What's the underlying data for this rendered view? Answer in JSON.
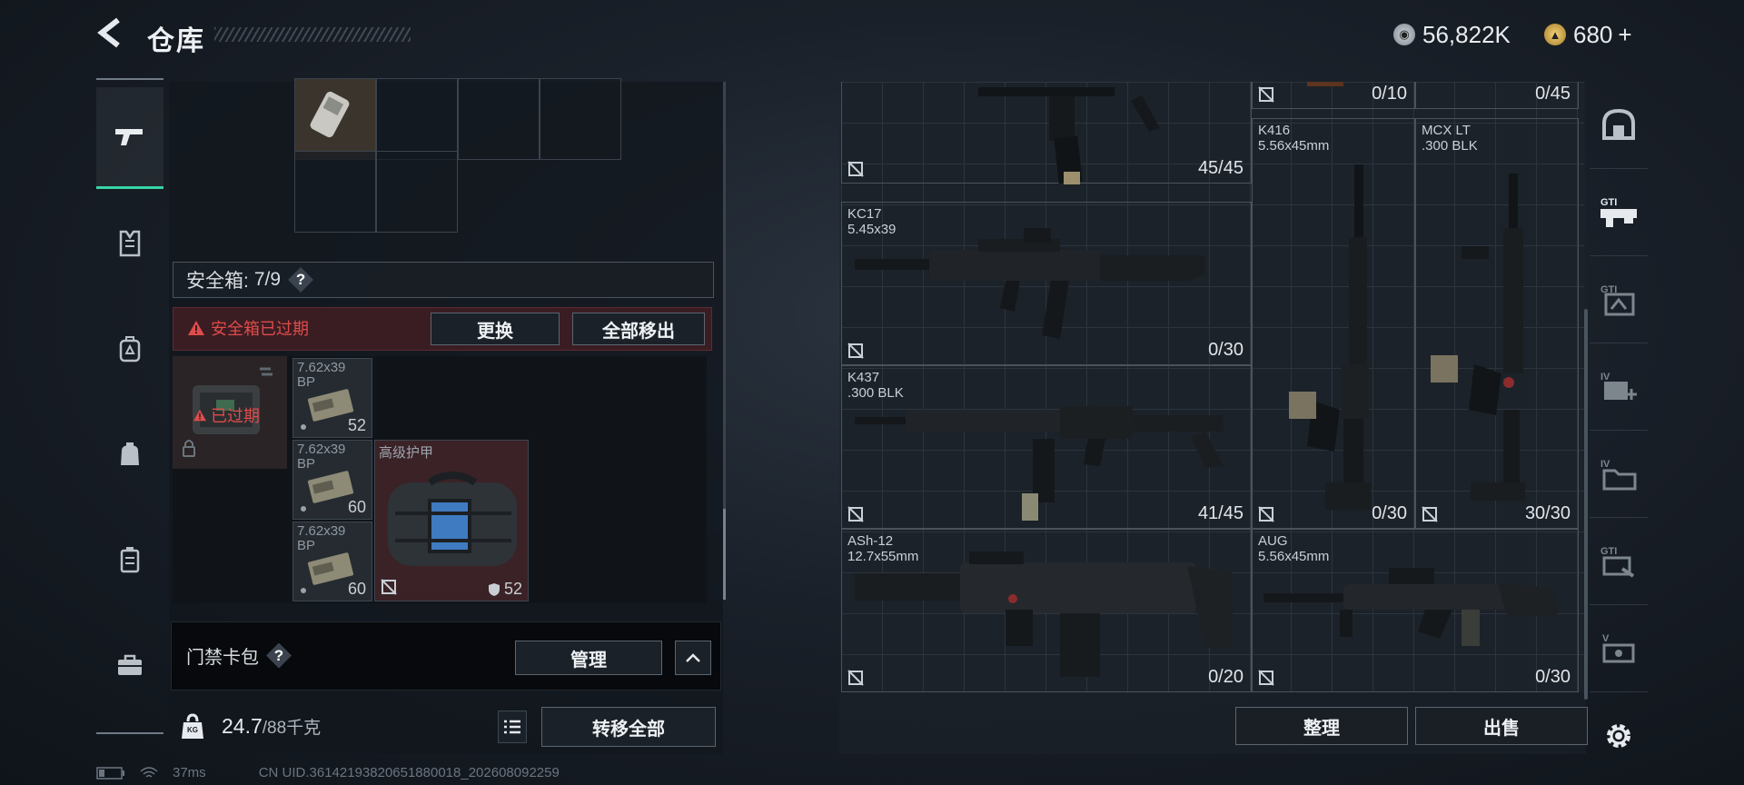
{
  "header": {
    "title": "仓库",
    "currency_primary": "56,822K",
    "currency_secondary": "680",
    "currency_secondary_plus": "+"
  },
  "safe_box": {
    "label": "安全箱:",
    "capacity": "7/9",
    "help": "?",
    "expired_notice": "安全箱已过期",
    "replace_button": "更换",
    "remove_all_button": "全部移出",
    "expired_badge": "已过期",
    "items": [
      {
        "label": "7.62x39",
        "sub": "BP",
        "count": "52"
      },
      {
        "label": "7.62x39",
        "sub": "BP",
        "count": "60"
      },
      {
        "label": "7.62x39",
        "sub": "BP",
        "count": "60"
      }
    ],
    "armor": {
      "label": "高级护甲",
      "durability": "52"
    }
  },
  "keycard": {
    "label": "门禁卡包",
    "help": "?",
    "manage_button": "管理"
  },
  "weight": {
    "current": "24.7",
    "max": "/88千克",
    "icon_text": "KG",
    "transfer_all_button": "转移全部"
  },
  "status_bar": {
    "ping": "37ms",
    "uid": "CN UID.3614219382065188001​8_202608092259"
  },
  "weapons": [
    {
      "name": "",
      "caliber": "",
      "count": "45/45"
    },
    {
      "name": "",
      "caliber": "",
      "count": "0/10"
    },
    {
      "name": "",
      "caliber": "",
      "count": "0/45"
    },
    {
      "name": "KC17",
      "caliber": "5.45x39",
      "count": "0/30"
    },
    {
      "name": "K416",
      "caliber": "5.56x45mm",
      "count": "0/30"
    },
    {
      "name": "MCX LT",
      "caliber": ".300 BLK",
      "count": "30/30"
    },
    {
      "name": "K437",
      "caliber": ".300 BLK",
      "count": "41/45"
    },
    {
      "name": "ASh-12",
      "caliber": "12.7x55mm",
      "count": "0/20"
    },
    {
      "name": "AUG",
      "caliber": "5.56x45mm",
      "count": "0/30"
    }
  ],
  "actions": {
    "sort_button": "整理",
    "sell_button": "出售"
  },
  "colors": {
    "accent": "#37d4a6",
    "danger": "#e04b4b",
    "coin_gold": "#d9b253"
  },
  "left_rail_icons": [
    "pistol-icon",
    "vest-icon",
    "backpack-icon",
    "bag-icon",
    "container-icon",
    "toolbox-icon"
  ],
  "right_rail_icons": [
    "helmet-icon",
    "gti-rifle-icon",
    "gti-mod-icon",
    "iv-add-icon",
    "iv-folder-icon",
    "gti-hand-icon",
    "v-card-icon",
    "gear-icon"
  ]
}
